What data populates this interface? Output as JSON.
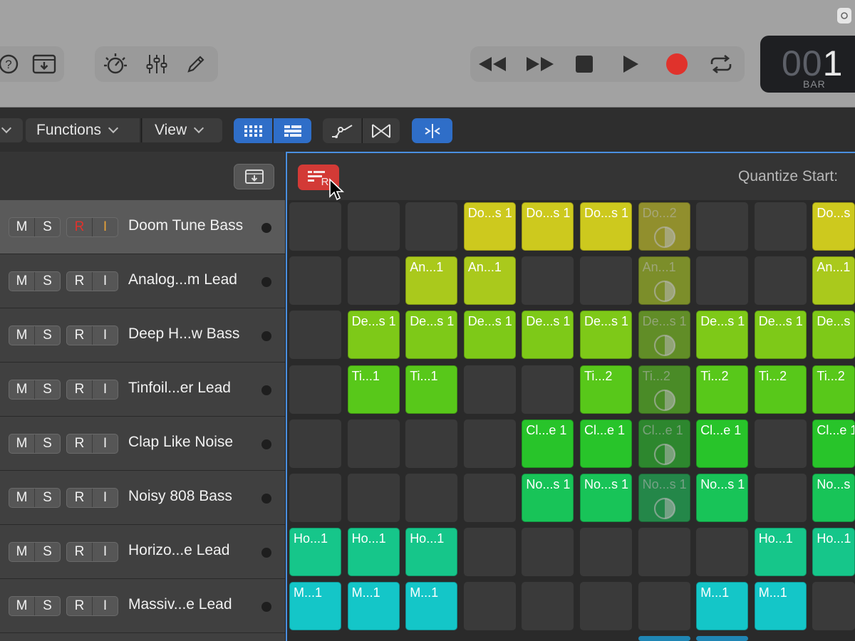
{
  "menu": {
    "functions_label": "Functions",
    "view_label": "View"
  },
  "transport": {
    "bar_display_dim": "00",
    "bar_display_lit": "1",
    "bar_label": "BAR"
  },
  "scene_header": {
    "quantize_label": "Quantize Start:"
  },
  "tracks": [
    {
      "name": "Doom Tune Bass",
      "m": "M",
      "s": "S",
      "r": "R",
      "i": "I",
      "selected": true,
      "record_armed": true
    },
    {
      "name": "Analog...m Lead",
      "m": "M",
      "s": "S",
      "r": "R",
      "i": "I"
    },
    {
      "name": "Deep H...w Bass",
      "m": "M",
      "s": "S",
      "r": "R",
      "i": "I"
    },
    {
      "name": "Tinfoil...er Lead",
      "m": "M",
      "s": "S",
      "r": "R",
      "i": "I"
    },
    {
      "name": "Clap Like Noise",
      "m": "M",
      "s": "S",
      "r": "R",
      "i": "I"
    },
    {
      "name": "Noisy 808 Bass",
      "m": "M",
      "s": "S",
      "r": "R",
      "i": "I"
    },
    {
      "name": "Horizo...e Lead",
      "m": "M",
      "s": "S",
      "r": "R",
      "i": "I"
    },
    {
      "name": "Massiv...e Lead",
      "m": "M",
      "s": "S",
      "r": "R",
      "i": "I"
    }
  ],
  "rows": [
    {
      "color": "#cdc91e",
      "cells": [
        null,
        null,
        null,
        "Do...s 1",
        "Do...s 1",
        "Do...s 1",
        "Do...2",
        null,
        null,
        "Do...s"
      ],
      "queued": [
        6
      ]
    },
    {
      "color": "#aac91c",
      "cells": [
        null,
        null,
        "An...1",
        "An...1",
        null,
        null,
        "An...1",
        null,
        null,
        "An...1"
      ],
      "queued": [
        6
      ]
    },
    {
      "color": "#7ec918",
      "cells": [
        null,
        "De...s 1",
        "De...s 1",
        "De...s 1",
        "De...s 1",
        "De...s 1",
        "De...s 1",
        "De...s 1",
        "De...s 1",
        "De...s"
      ],
      "queued": [
        6
      ]
    },
    {
      "color": "#58c81a",
      "cells": [
        null,
        "Ti...1",
        "Ti...1",
        null,
        null,
        "Ti...2",
        "Ti...2",
        "Ti...2",
        "Ti...2",
        "Ti...2"
      ],
      "queued": [
        6
      ]
    },
    {
      "color": "#28c42a",
      "cells": [
        null,
        null,
        null,
        null,
        "Cl...e 1",
        "Cl...e 1",
        "Cl...e 1",
        "Cl...e 1",
        null,
        "Cl...e 1"
      ],
      "queued": [
        6
      ]
    },
    {
      "color": "#18c458",
      "cells": [
        null,
        null,
        null,
        null,
        "No...s 1",
        "No...s 1",
        "No...s 1",
        "No...s 1",
        null,
        "No...s"
      ],
      "queued": [
        6
      ]
    },
    {
      "color": "#16c68a",
      "cells": [
        "Ho...1",
        "Ho...1",
        "Ho...1",
        null,
        null,
        null,
        null,
        null,
        "Ho...1",
        "Ho...1"
      ],
      "queued": []
    },
    {
      "color": "#14c6c8",
      "cells": [
        "M...1",
        "M...1",
        "M...1",
        null,
        null,
        null,
        null,
        "M...1",
        "M...1",
        null
      ],
      "queued": []
    }
  ],
  "colors": {
    "accent_blue": "#2f6ec8",
    "record_red": "#e0322c",
    "record_button_red": "#d33a36"
  },
  "icons": [
    "help-icon",
    "download-icon",
    "metronome-icon",
    "mixer-icon",
    "pencil-icon",
    "rewind-icon",
    "fast-forward-icon",
    "stop-icon",
    "play-icon",
    "record-icon",
    "cycle-icon",
    "grid-view-icon",
    "list-view-icon",
    "automation-icon",
    "crossfade-icon",
    "snap-icon",
    "record-scene-icon",
    "cursor-icon"
  ]
}
